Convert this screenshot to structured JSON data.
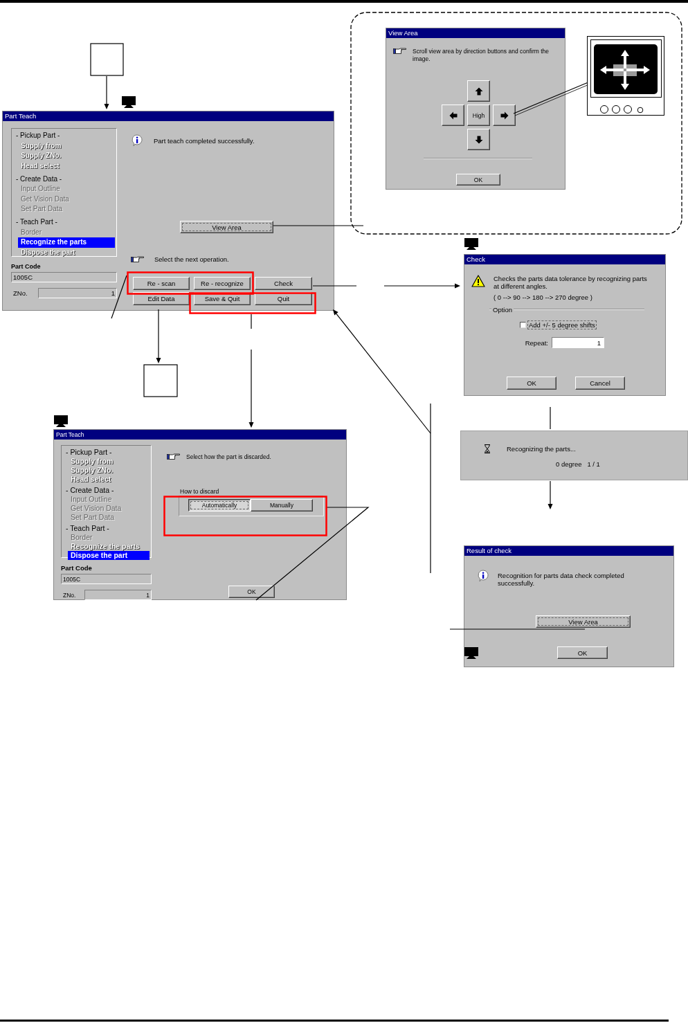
{
  "part_teach": {
    "title": "Part Teach",
    "steps": [
      {
        "heading": "- Pickup Part -",
        "items": [
          {
            "label": "Supply from",
            "selected": false,
            "disabled": false
          },
          {
            "label": "Supply ZNo.",
            "selected": false,
            "disabled": false
          },
          {
            "label": "Head select",
            "selected": false,
            "disabled": false
          }
        ]
      },
      {
        "heading": "- Create Data -",
        "items": [
          {
            "label": "Input Outline",
            "selected": false,
            "disabled": true
          },
          {
            "label": "Get Vision Data",
            "selected": false,
            "disabled": true
          },
          {
            "label": "Set Part Data",
            "selected": false,
            "disabled": true
          }
        ]
      },
      {
        "heading": "- Teach Part -",
        "items": [
          {
            "label": "Border",
            "selected": false,
            "disabled": true
          },
          {
            "label": "Recognize the parts",
            "selected": true,
            "disabled": false
          },
          {
            "label": "Dispose the part",
            "selected": false,
            "disabled": false
          }
        ]
      }
    ],
    "part_code_label": "Part Code",
    "part_code": "1005C",
    "zno_label": "ZNo.",
    "zno": "1",
    "message": "Part teach completed successfully.",
    "view_area_button": "View Area",
    "prompt": "Select the next operation.",
    "buttons": [
      "Re - scan",
      "Re - recognize",
      "Check",
      "Edit Data",
      "Save & Quit",
      "Quit"
    ]
  },
  "view_area": {
    "title": "View Area",
    "prompt": "Scroll view area by direction buttons and confirm the image.",
    "center_button": "High",
    "ok_button": "OK"
  },
  "check": {
    "title": "Check",
    "message": "Checks the parts data tolerance by recognizing parts at different angles.",
    "angles": "( 0 --> 90 --> 180 --> 270 degree )",
    "option_label": "Option",
    "shift_option": {
      "label": "Add +/- 5 degree shifts",
      "checked": false
    },
    "repeat_label": "Repeat:",
    "repeat": "1",
    "buttons": [
      "OK",
      "Cancel"
    ]
  },
  "progress": {
    "message": "Recognizing the parts...",
    "status": "0 degree   1 / 1"
  },
  "result": {
    "title": "Result of check",
    "message": "Recognition for parts data check completed successfully.",
    "view_area_button": "View Area",
    "ok_button": "OK"
  },
  "dispose": {
    "title": "Part Teach",
    "steps": [
      {
        "heading": "- Pickup Part -",
        "items": [
          {
            "label": "Supply from",
            "selected": false,
            "disabled": false
          },
          {
            "label": "Supply ZNo.",
            "selected": false,
            "disabled": false
          },
          {
            "label": "Head select",
            "selected": false,
            "disabled": false
          }
        ]
      },
      {
        "heading": "- Create Data -",
        "items": [
          {
            "label": "Input Outline",
            "selected": false,
            "disabled": true
          },
          {
            "label": "Get Vision Data",
            "selected": false,
            "disabled": true
          },
          {
            "label": "Set Part Data",
            "selected": false,
            "disabled": true
          }
        ]
      },
      {
        "heading": "- Teach Part -",
        "items": [
          {
            "label": "Border",
            "selected": false,
            "disabled": true
          },
          {
            "label": "Recognize the parts",
            "selected": false,
            "disabled": false
          },
          {
            "label": "Dispose the part",
            "selected": true,
            "disabled": false
          }
        ]
      }
    ],
    "part_code_label": "Part Code",
    "part_code": "1005C",
    "zno_label": "ZNo.",
    "zno": "1",
    "prompt": "Select how the part is discarded.",
    "group_label": "How to discard",
    "options": [
      {
        "label": "Automatically",
        "selected": true
      },
      {
        "label": "Manually",
        "selected": false
      }
    ],
    "ok_button": "OK"
  }
}
